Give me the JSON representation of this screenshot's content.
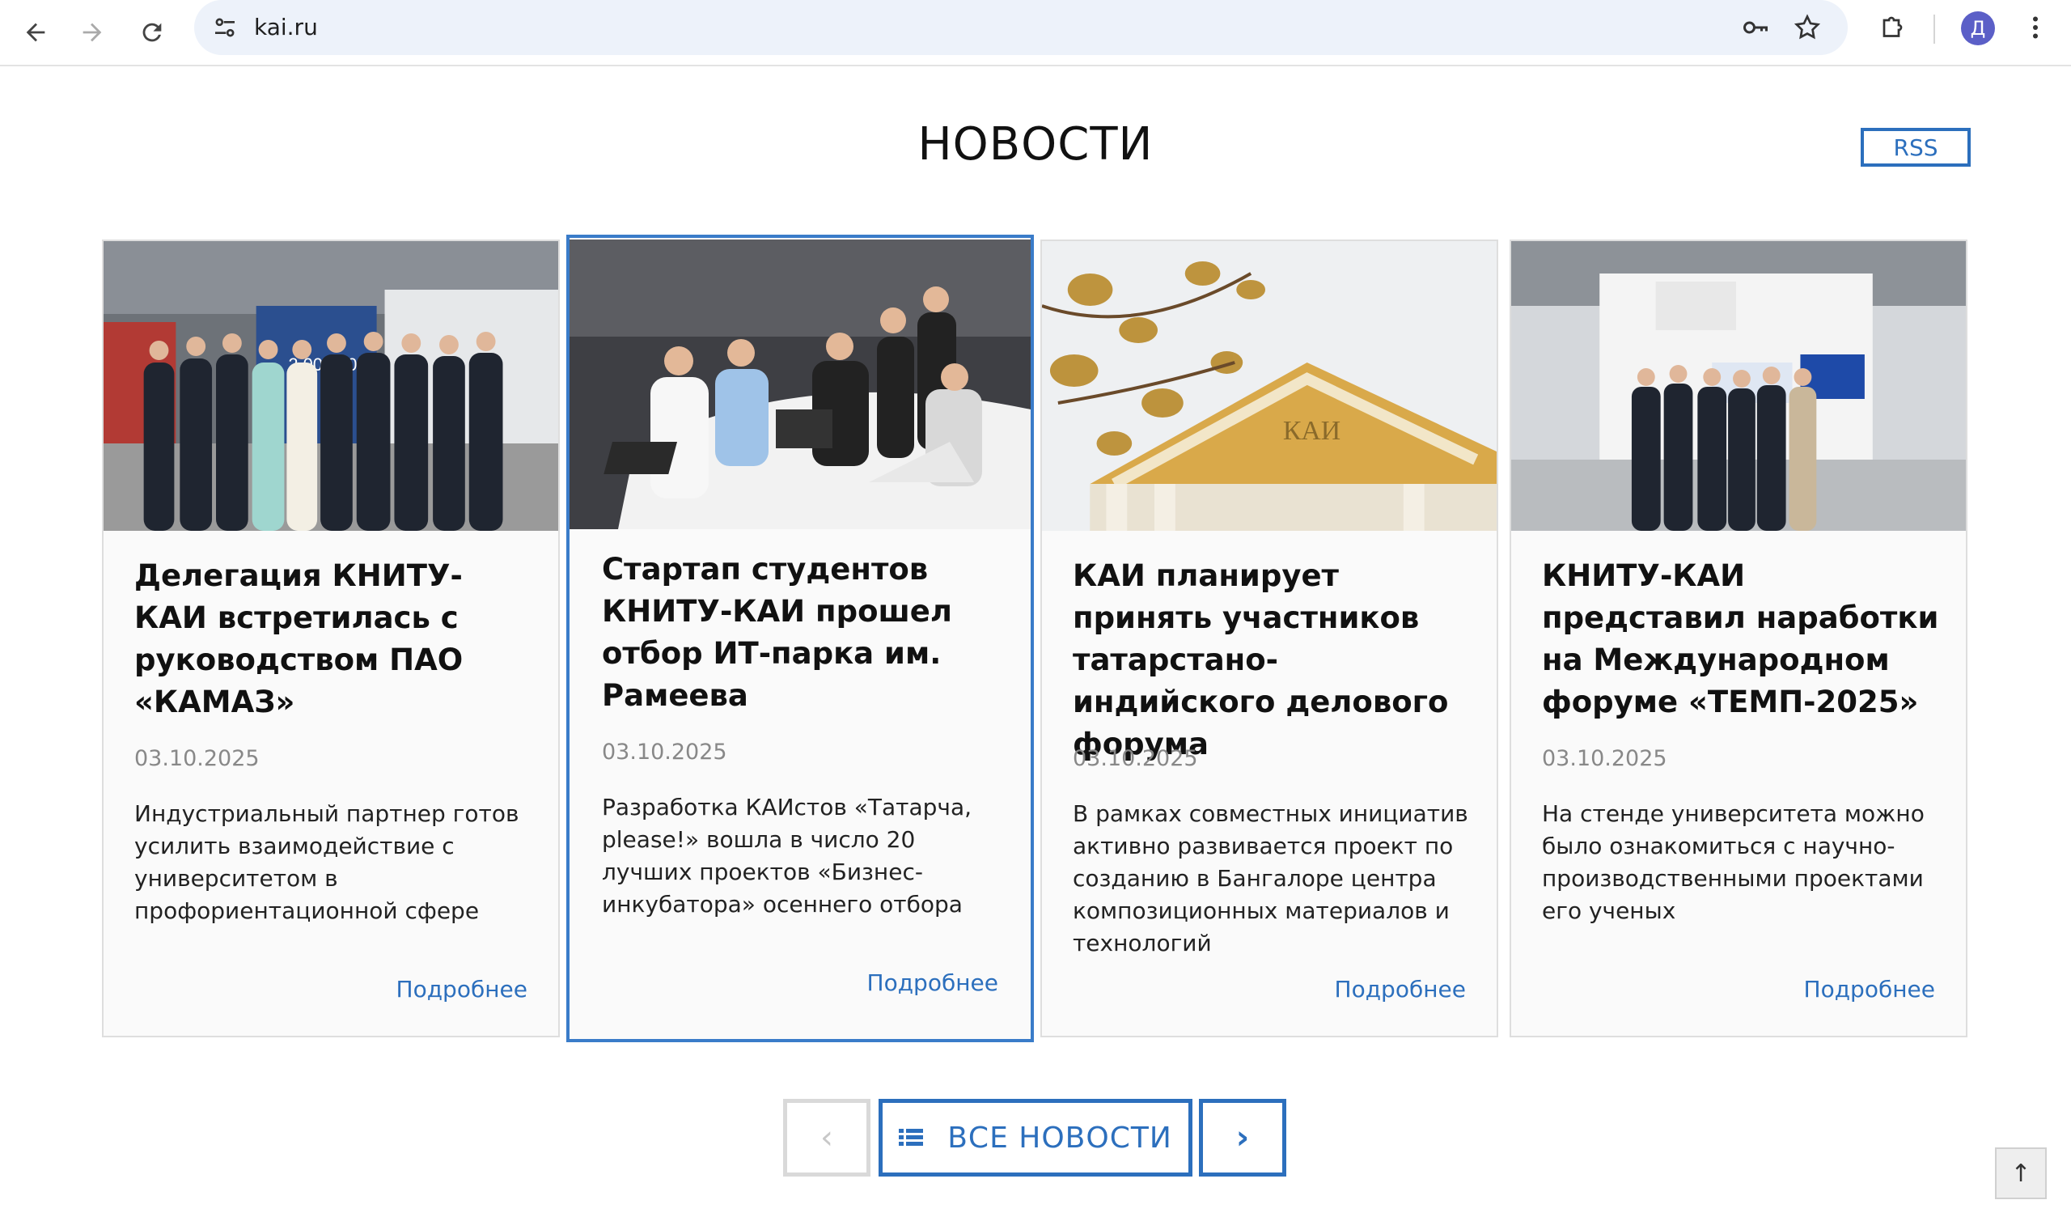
{
  "browser": {
    "url": "kai.ru",
    "profile_initial": "Д"
  },
  "page": {
    "heading": "НОВОСТИ",
    "rss_label": "RSS"
  },
  "cards": [
    {
      "title": "Делегация КНИТУ-КАИ встретилась с руководством ПАО «КАМАЗ»",
      "date": "03.10.2025",
      "description": "Индустриальный партнер готов усилить взаимодействие с университетом в профориентационной сфере",
      "more_label": "Подробнее",
      "photo_text": "2 000 000"
    },
    {
      "title": "Стартап студентов КНИТУ-КАИ прошел отбор ИТ-парка им. Рамеева",
      "date": "03.10.2025",
      "description": "Разработка КАИстов «Татарча, please!» вошла в число 20 лучших проектов «Бизнес-инкубатора» осеннего отбора",
      "more_label": "Подробнее"
    },
    {
      "title": "КАИ планирует принять участников татарстано-индийского делового форума",
      "date": "03.10.2025",
      "description": "В рамках совместных инициатив активно развивается проект по созданию в Бангалоре центра композиционных материалов и технологий",
      "more_label": "Подробнее"
    },
    {
      "title": "КНИТУ-КАИ представил наработки на Международном форуме «ТЕМП-2025»",
      "date": "03.10.2025",
      "description": "На стенде университета можно было ознакомиться с научно-производственными проектами его ученых",
      "more_label": "Подробнее"
    }
  ],
  "pager": {
    "prev_symbol": "‹",
    "all_label": "ВСЕ НОВОСТИ",
    "next_symbol": "›",
    "to_top_symbol": "↑"
  },
  "colors": {
    "accent": "#2c6fbd",
    "card_bg": "#fafafa",
    "date": "#888888"
  }
}
